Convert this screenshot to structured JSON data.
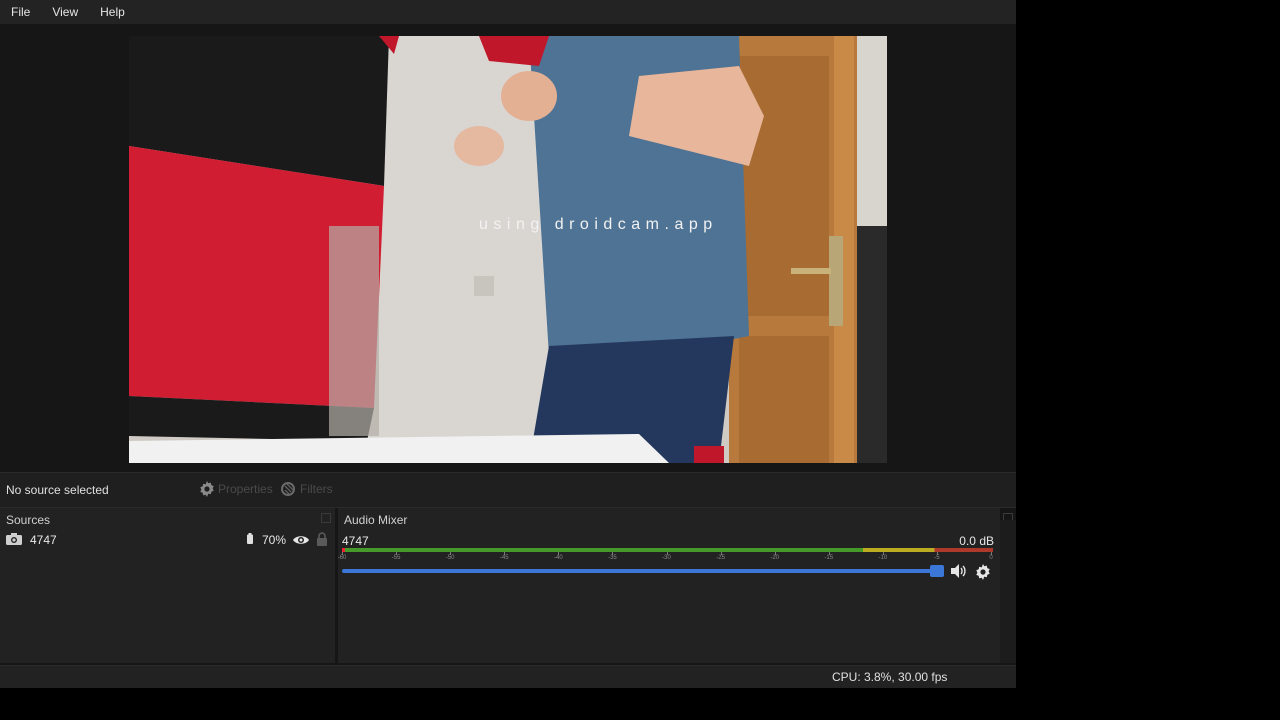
{
  "menu": {
    "items": [
      {
        "label": "File"
      },
      {
        "label": "View"
      },
      {
        "label": "Help"
      }
    ]
  },
  "preview": {
    "watermark": "using droidcam.app"
  },
  "toolbar": {
    "selection_text": "No source selected",
    "properties_label": "Properties",
    "filters_label": "Filters"
  },
  "sources": {
    "title": "Sources",
    "items": [
      {
        "name": "4747",
        "battery_percent": "70%",
        "icon": "camera-icon",
        "visible": true,
        "locked": false
      }
    ]
  },
  "mixer": {
    "title": "Audio Mixer",
    "channel": {
      "name": "4747",
      "level": "0.0 dB",
      "volume_fraction": 1.0,
      "tick_labels": [
        "-60",
        "-55",
        "-50",
        "-45",
        "-40",
        "-35",
        "-30",
        "-25",
        "-20",
        "-15",
        "-10",
        "-5",
        "0"
      ]
    }
  },
  "status": {
    "text": "CPU: 3.8%, 30.00 fps"
  },
  "colors": {
    "accent": "#3a77d6",
    "meter_green": "#4caf2a",
    "meter_yellow": "#d6c422",
    "meter_red": "#c43d2a"
  }
}
